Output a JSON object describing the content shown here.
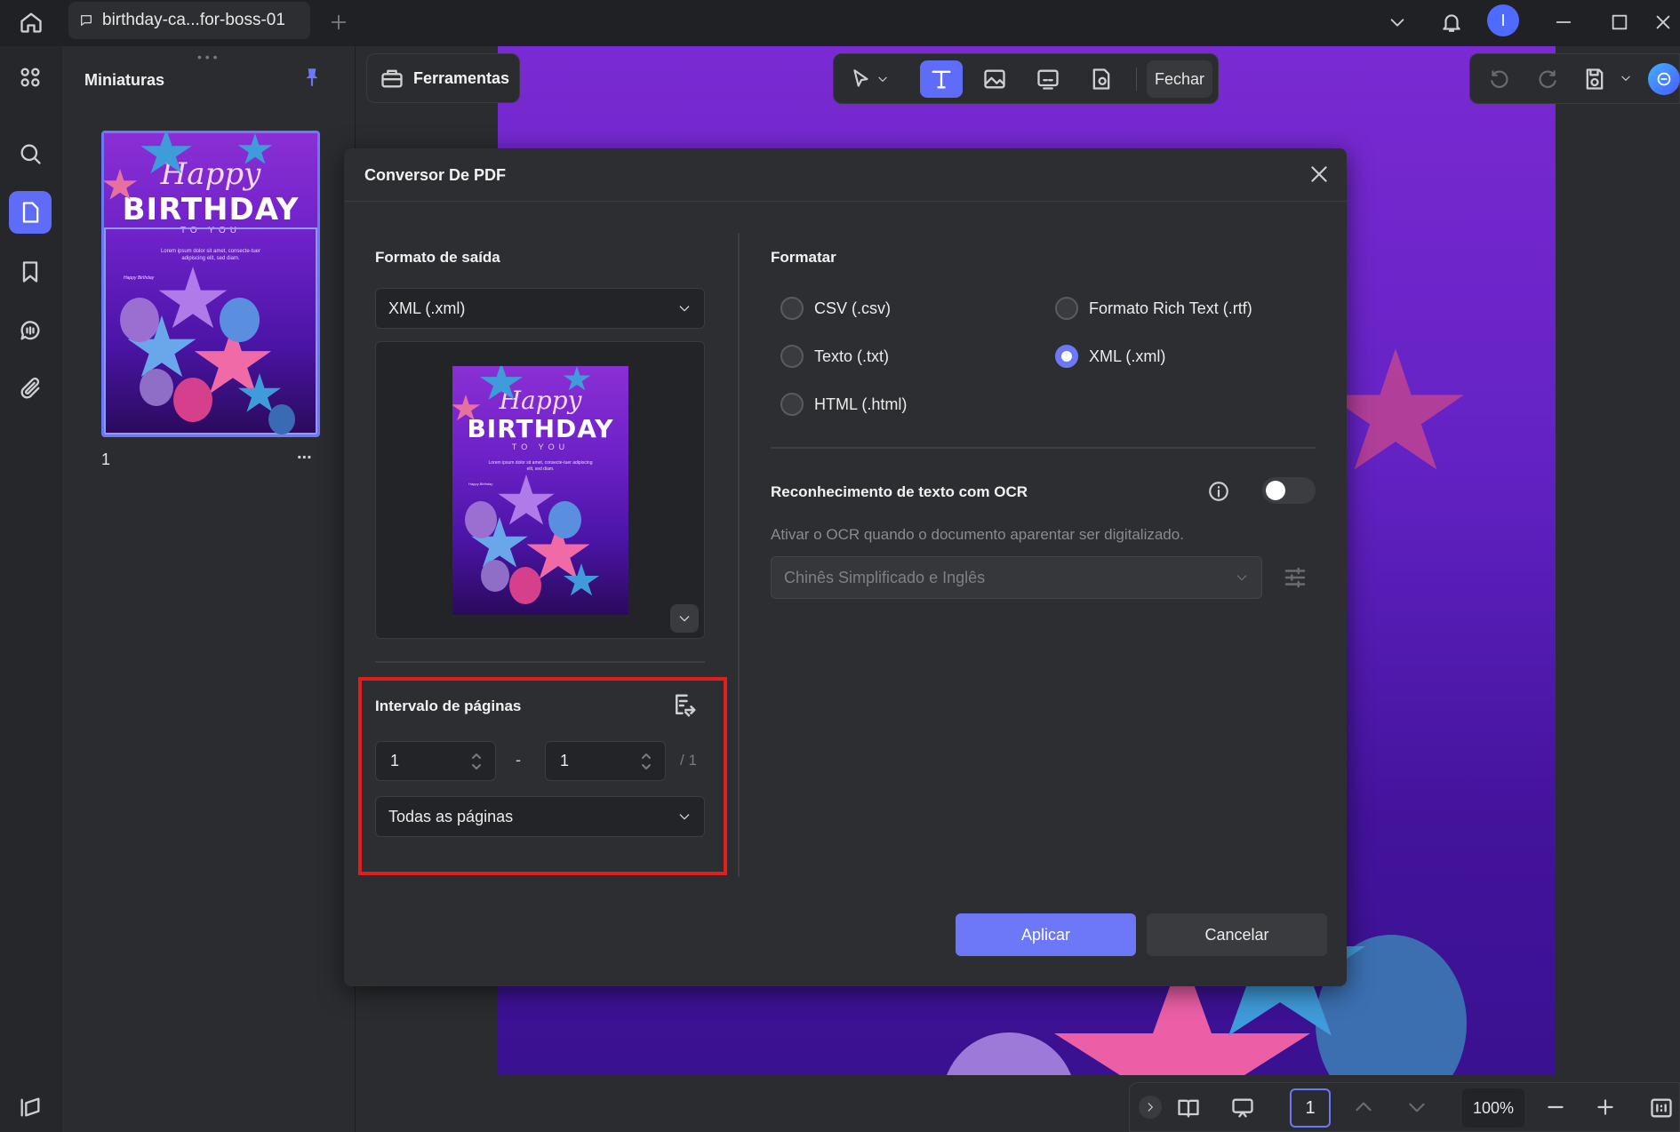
{
  "titlebar": {
    "tab_title": "birthday-ca...for-boss-01",
    "avatar_initial": "I"
  },
  "sidebar": {
    "title": "Miniaturas",
    "page_number": "1",
    "more": "..."
  },
  "poster": {
    "happy": "Happy",
    "birthday": "BIRTHDAY",
    "to_you": "TO YOU",
    "lorem": "Lorem ipsum dolor sit amet, consecte-tuer adipiscing elit, sed diam.",
    "happy_birthday_small": "Happy Birthday"
  },
  "toolbar": {
    "tools_label": "Ferramentas",
    "close_label": "Fechar"
  },
  "dialog": {
    "title": "Conversor De PDF",
    "output_format_label": "Formato de saída",
    "output_format_value": "XML (.xml)",
    "page_range_label": "Intervalo de páginas",
    "range_from": "1",
    "range_sep": "-",
    "range_to": "1",
    "range_total": "/ 1",
    "page_subset_value": "Todas as páginas",
    "format_label": "Formatar",
    "formats": [
      {
        "label": "CSV (.csv)",
        "selected": false
      },
      {
        "label": "Formato Rich Text (.rtf)",
        "selected": false
      },
      {
        "label": "Texto (.txt)",
        "selected": false
      },
      {
        "label": "XML (.xml)",
        "selected": true
      },
      {
        "label": "HTML (.html)",
        "selected": false
      }
    ],
    "ocr_label": "Reconhecimento de texto com OCR",
    "ocr_hint": "Ativar o OCR quando o documento aparentar ser digitalizado.",
    "ocr_language": "Chinês Simplificado e Inglês",
    "ocr_enabled": false,
    "apply_label": "Aplicar",
    "cancel_label": "Cancelar"
  },
  "bottombar": {
    "page": "1",
    "zoom": "100%"
  },
  "colors": {
    "accent": "#5f6cf7",
    "highlight": "#e11d1d"
  }
}
